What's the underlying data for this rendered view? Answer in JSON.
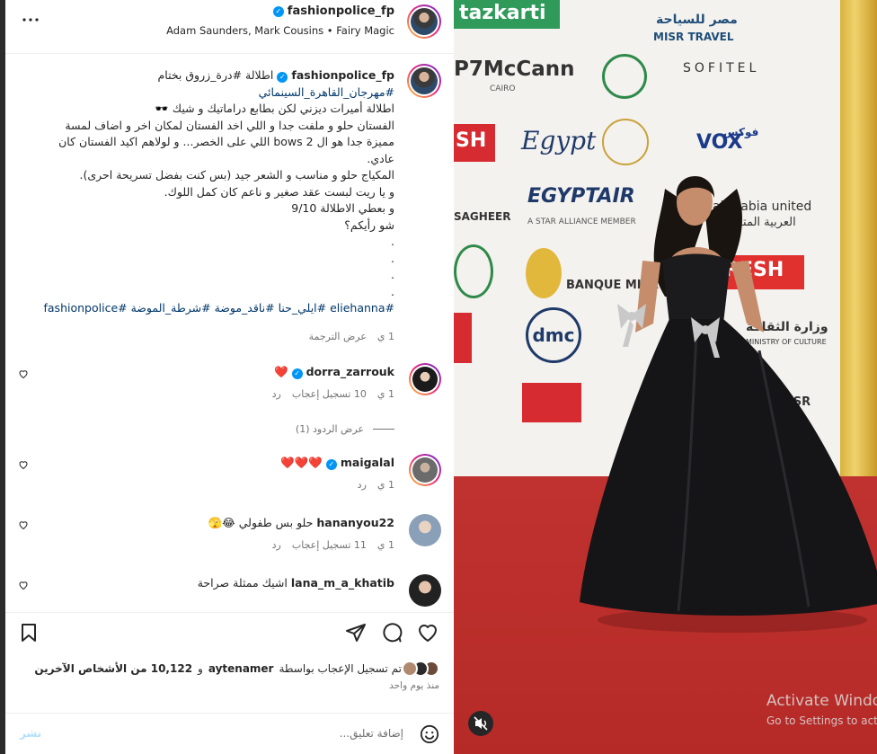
{
  "header": {
    "username": "fashionpolice_fp",
    "subtitle": "Adam Saunders, Mark Cousins • Fairy Magic"
  },
  "caption": {
    "username": "fashionpolice_fp",
    "lines": [
      "اطلالة #درة_زروق بختام",
      "#مهرجان_القاهرة_السينمائي",
      "اطلالة أميرات ديزني لكن بطابع دراماتيك و شيك 🕶️",
      "الفستان حلو و ملفت جدا و اللي اخد الفستان لمكان اخر و اضاف لمسة",
      "مميزة جدا هو ال 2 bows اللي على الخصر... و لولاهم اكيد الفستان كان",
      "عادي.",
      "المكياج حلو و مناسب و الشعر جيد (بس كنت بفضل تسريحة احرى).",
      "و يا ريت لبست عقد صغير و ناعم كان كمل اللوك.",
      "و بعطي الاطلالة 9/10",
      "شو رأيكم؟",
      ".",
      ".",
      ".",
      ".",
      "#eliehanna #ايلي_حنا #ناقد_موضة #شرطة_الموضة #fashionpolice"
    ],
    "time": "1 ي",
    "see_translation": "عرض الترجمة"
  },
  "comments": [
    {
      "username": "dorra_zarrouk",
      "text": "❤️",
      "time": "1 ي",
      "likes": "10 تسجيل إعجاب",
      "reply": "رد",
      "verified": true
    },
    {
      "username": "maigalal",
      "text": "❤️❤️❤️",
      "time": "1 ي",
      "likes": "",
      "reply": "رد",
      "verified": true
    },
    {
      "username": "hananyou22",
      "text": "حلو بس طفولي 😂🫣",
      "time": "1 ي",
      "likes": "11 تسجيل إعجاب",
      "reply": "رد",
      "verified": false
    },
    {
      "username": "lana_m_a_khatib",
      "text": "اشيك ممثلة صراحة",
      "time": "",
      "likes": "",
      "reply": "",
      "verified": false
    }
  ],
  "view_replies": "عرض الردود (1)",
  "likes_line": {
    "prefix": "تم تسجيل الإعجاب بواسطة",
    "user": "aytenamer",
    "and": "و",
    "count": "10,122 من الأشخاص الآخرين"
  },
  "time_ago": "منذ يوم واحد",
  "comment_box": {
    "placeholder": "إضافة تعليق...",
    "post": "نشر"
  },
  "photo": {
    "sponsors": [
      "tazkarti",
      "MISR TRAVEL",
      "P7McCann",
      "CAIRO",
      "SOFITEL",
      "Egypt",
      "VOX",
      "EGYPTAIR",
      "A STAR ALLIANCE MEMBER",
      "al arabia united",
      "SAGHEER",
      "FRESH",
      "BANQUE MISR",
      "dmc",
      "وزارة الثقافة",
      "MINISTRY OF CULTURE",
      "مصر للسياحة",
      "فوكس",
      "العربية المتحدة",
      "MISR"
    ],
    "watermark_title": "Activate Windows",
    "watermark_sub": "Go to Settings to activate Windows."
  }
}
